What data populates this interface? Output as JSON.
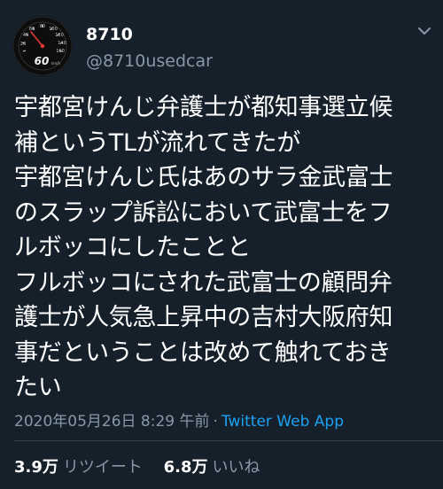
{
  "user": {
    "display_name": "8710",
    "handle": "@8710usedcar",
    "avatar_speed": "60",
    "avatar_unit": "km/h",
    "avatar_dial_labels": [
      "40",
      "60",
      "80",
      "100",
      "120",
      "140",
      "160",
      "20"
    ]
  },
  "tweet": {
    "lines": [
      "宇都宮けんじ弁護士が都知事選立候",
      "補というTLが流れてきたが",
      "宇都宮けんじ氏はあのサラ金武富士",
      "のスラップ訴訟において武富士をフ",
      "ルボッコにしたことと",
      "フルボッコにされた武富士の顧問弁",
      "護士が人気急上昇中の吉村大阪府知",
      "事だということは改めて触れておき",
      "たい"
    ],
    "timestamp": "2020年05月26日 8:29 午前",
    "separator": "·",
    "source": "Twitter Web App"
  },
  "stats": {
    "retweets_count": "3.9万",
    "retweets_label": "リツイート",
    "likes_count": "6.8万",
    "likes_label": "いいね"
  },
  "colors": {
    "background": "#15202b",
    "text": "#ffffff",
    "secondary": "#8899a6",
    "link": "#1da1f2",
    "divider": "#38444d"
  },
  "icons": {
    "menu": "chevron-down-icon",
    "avatar": "speedometer-icon"
  }
}
